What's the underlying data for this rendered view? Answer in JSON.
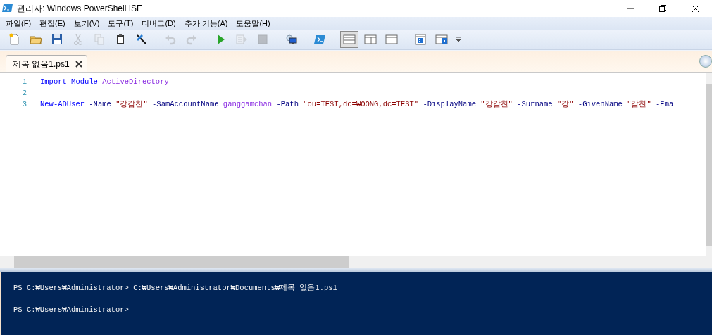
{
  "window": {
    "title": "관리자: Windows PowerShell ISE"
  },
  "menu": [
    "파일(F)",
    "편집(E)",
    "보기(V)",
    "도구(T)",
    "디버그(D)",
    "추가 기능(A)",
    "도움말(H)"
  ],
  "toolbar": [
    [
      {
        "kind": "new",
        "disabled": false,
        "selected": false
      },
      {
        "kind": "open",
        "disabled": false,
        "selected": false
      },
      {
        "kind": "save",
        "disabled": false,
        "selected": false
      },
      {
        "kind": "cut",
        "disabled": true,
        "selected": false
      },
      {
        "kind": "copy",
        "disabled": true,
        "selected": false
      },
      {
        "kind": "paste",
        "disabled": false,
        "selected": false
      },
      {
        "kind": "clear",
        "disabled": false,
        "selected": false
      }
    ],
    [
      {
        "kind": "undo",
        "disabled": true,
        "selected": false
      },
      {
        "kind": "redo",
        "disabled": true,
        "selected": false
      }
    ],
    [
      {
        "kind": "run",
        "disabled": false,
        "selected": false
      },
      {
        "kind": "runsel",
        "disabled": true,
        "selected": false
      },
      {
        "kind": "stop",
        "disabled": true,
        "selected": false
      }
    ],
    [
      {
        "kind": "remote",
        "disabled": false,
        "selected": false
      }
    ],
    [
      {
        "kind": "console",
        "disabled": false,
        "selected": false
      }
    ],
    [
      {
        "kind": "paneTop",
        "disabled": false,
        "selected": true
      },
      {
        "kind": "paneRight",
        "disabled": false,
        "selected": false
      },
      {
        "kind": "paneMax",
        "disabled": false,
        "selected": false
      }
    ],
    [
      {
        "kind": "showScript",
        "disabled": false,
        "selected": false
      },
      {
        "kind": "showConsole",
        "disabled": false,
        "selected": false
      },
      {
        "kind": "overflow",
        "disabled": false,
        "selected": false
      }
    ]
  ],
  "tabs": [
    {
      "label": "제목 없음1.ps1",
      "selected": true
    }
  ],
  "editor": {
    "lines": [
      {
        "number": "1",
        "tokens": [
          {
            "text": "Import-Module",
            "kind": "command"
          },
          {
            "text": "ActiveDirectory",
            "kind": "argument"
          }
        ]
      },
      {
        "number": "2"
      },
      {
        "number": "3",
        "tokens": [
          {
            "text": "New-ADUser",
            "kind": "command"
          },
          {
            "text": "-Name",
            "kind": "parameter"
          },
          {
            "text": "\"강감찬\"",
            "kind": "string"
          },
          {
            "text": "-SamAccountName",
            "kind": "parameter"
          },
          {
            "text": "ganggamchan",
            "kind": "argument"
          },
          {
            "text": "-Path",
            "kind": "parameter"
          },
          {
            "text": "\"ou=TEST,dc=₩OONG,dc=TEST\"",
            "kind": "string"
          },
          {
            "text": "-DisplayName",
            "kind": "parameter"
          },
          {
            "text": "\"강감찬\"",
            "kind": "string"
          },
          {
            "text": "-Surname",
            "kind": "parameter"
          },
          {
            "text": "\"강\"",
            "kind": "string"
          },
          {
            "text": "-GivenName",
            "kind": "parameter"
          },
          {
            "text": "\"감찬\"",
            "kind": "string"
          },
          {
            "text": "-Ema",
            "kind": "parameter"
          }
        ]
      }
    ]
  },
  "console": {
    "lines": [
      "PS C:₩Users₩Administrator> C:₩Users₩Administrator₩Documents₩제목 없음1.ps1",
      "PS C:₩Users₩Administrator>"
    ]
  }
}
